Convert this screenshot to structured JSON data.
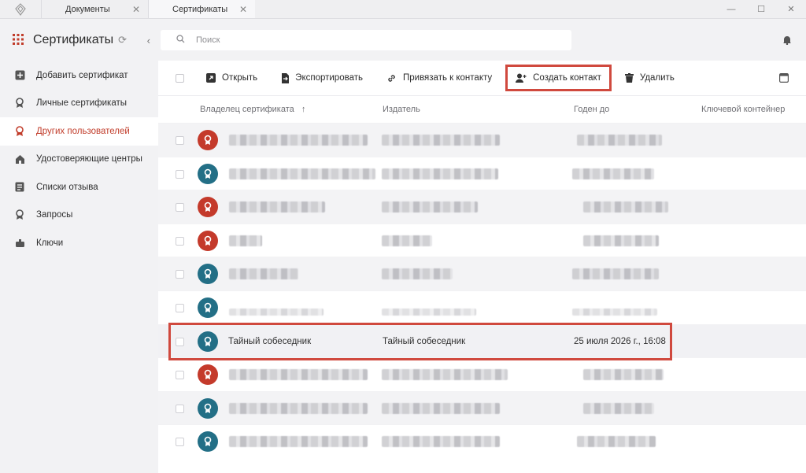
{
  "tabs": [
    {
      "label": "Документы"
    },
    {
      "label": "Сертификаты"
    }
  ],
  "sidebar": {
    "title": "Сертификаты",
    "items": [
      {
        "label": "Добавить сертификат",
        "icon": "plus-square-icon"
      },
      {
        "label": "Личные сертификаты",
        "icon": "ribbon-icon"
      },
      {
        "label": "Других пользователей",
        "icon": "ribbon-icon",
        "active": true
      },
      {
        "label": "Удостоверяющие центры",
        "icon": "home-icon"
      },
      {
        "label": "Списки отзыва",
        "icon": "list-icon"
      },
      {
        "label": "Запросы",
        "icon": "ribbon-icon"
      },
      {
        "label": "Ключи",
        "icon": "key-icon"
      }
    ]
  },
  "search": {
    "placeholder": "Поиск"
  },
  "toolbar": {
    "open": "Открыть",
    "export": "Экспортировать",
    "link_contact": "Привязать к контакту",
    "create_contact": "Создать контакт",
    "delete": "Удалить"
  },
  "table": {
    "columns": [
      "Владелец сертификата",
      "Издатель",
      "Годен до",
      "Ключевой контейнер"
    ],
    "sort_indicator": "↑",
    "selected_row": {
      "owner": "Тайный собеседник",
      "issuer": "Тайный собеседник",
      "valid_to": "25 июля 2026 г., 16:08"
    }
  },
  "colors": {
    "accent": "#c13c2a",
    "highlight": "#d0493e",
    "avatar_red": "#c43a2b",
    "avatar_teal": "#236f86"
  }
}
